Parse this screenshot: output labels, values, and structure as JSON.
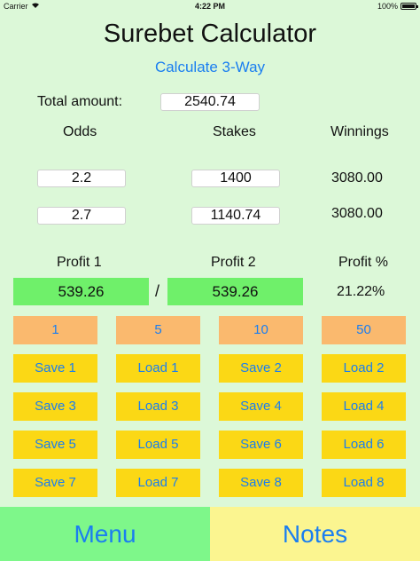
{
  "status_bar": {
    "carrier": "Carrier",
    "time": "4:22 PM",
    "battery": "100%",
    "wifi_icon": "wifi-icon",
    "battery_icon": "battery-icon"
  },
  "header": {
    "title": "Surebet Calculator",
    "mode_link": "Calculate 3-Way"
  },
  "total": {
    "label": "Total amount:",
    "value": "2540.74"
  },
  "columns": {
    "odds": "Odds",
    "stakes": "Stakes",
    "winnings": "Winnings"
  },
  "rows": [
    {
      "odds": "2.2",
      "stake": "1400",
      "winnings": "3080.00"
    },
    {
      "odds": "2.7",
      "stake": "1140.74",
      "winnings": "3080.00"
    }
  ],
  "profit": {
    "profit1_label": "Profit 1",
    "profit2_label": "Profit 2",
    "percent_label": "Profit %",
    "profit1_value": "539.26",
    "separator": "/",
    "profit2_value": "539.26",
    "percent_value": "21.22%"
  },
  "round_buttons": [
    "1",
    "5",
    "10",
    "50"
  ],
  "slot_buttons": [
    [
      "Save 1",
      "Load 1",
      "Save 2",
      "Load 2"
    ],
    [
      "Save 3",
      "Load 3",
      "Save 4",
      "Load 4"
    ],
    [
      "Save 5",
      "Load 5",
      "Save 6",
      "Load 6"
    ],
    [
      "Save 7",
      "Load 7",
      "Save 8",
      "Load 8"
    ]
  ],
  "footer": {
    "menu": "Menu",
    "notes": "Notes"
  },
  "colors": {
    "background": "#dcf8d8",
    "accent_blue": "#1a7ef0",
    "profit_green": "#6ff06a",
    "round_orange": "#fab96e",
    "slot_yellow": "#fbd815",
    "menu_green": "#7ef78a",
    "notes_yellow": "#fbf590"
  }
}
